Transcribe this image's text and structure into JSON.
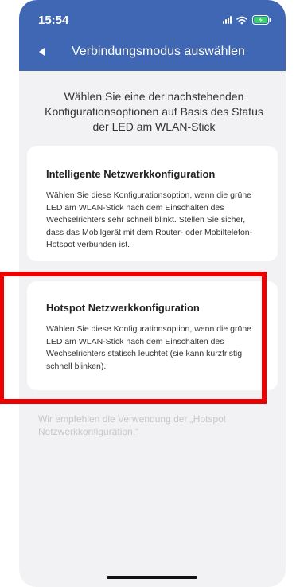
{
  "status_bar": {
    "time": "15:54",
    "icons": [
      "signal-icon",
      "wifi-icon",
      "battery-charging-icon"
    ]
  },
  "header": {
    "back_icon": "back-arrow-icon",
    "title": "Verbindungsmodus auswählen",
    "color": "#3f67b3"
  },
  "intro_text": "Wählen Sie eine der nachstehenden Konfigurationsoptionen auf Basis des Status der LED am WLAN-Stick",
  "options": [
    {
      "title": "Intelligente Netzwerkkonfiguration",
      "description": "Wählen Sie diese Konfigurationsoption, wenn die grüne LED am WLAN-Stick nach dem Einschalten des Wechselrichters sehr schnell blinkt. Stellen Sie sicher, dass das Mobilgerät mit dem Router- oder Mobiltelefon-Hotspot verbunden ist."
    },
    {
      "title": "Hotspot Netzwerkkonfiguration",
      "description": "Wählen Sie diese Konfigurationsoption, wenn die grüne LED am WLAN-Stick nach dem Einschalten des Wechselrichters statisch leuchtet (sie kann kurzfristig schnell blinken)."
    }
  ],
  "recommendation": "Wir empfehlen die Verwendung der „Hotspot Netzwerkkonfiguration.“",
  "highlight_color": "#ee0000"
}
